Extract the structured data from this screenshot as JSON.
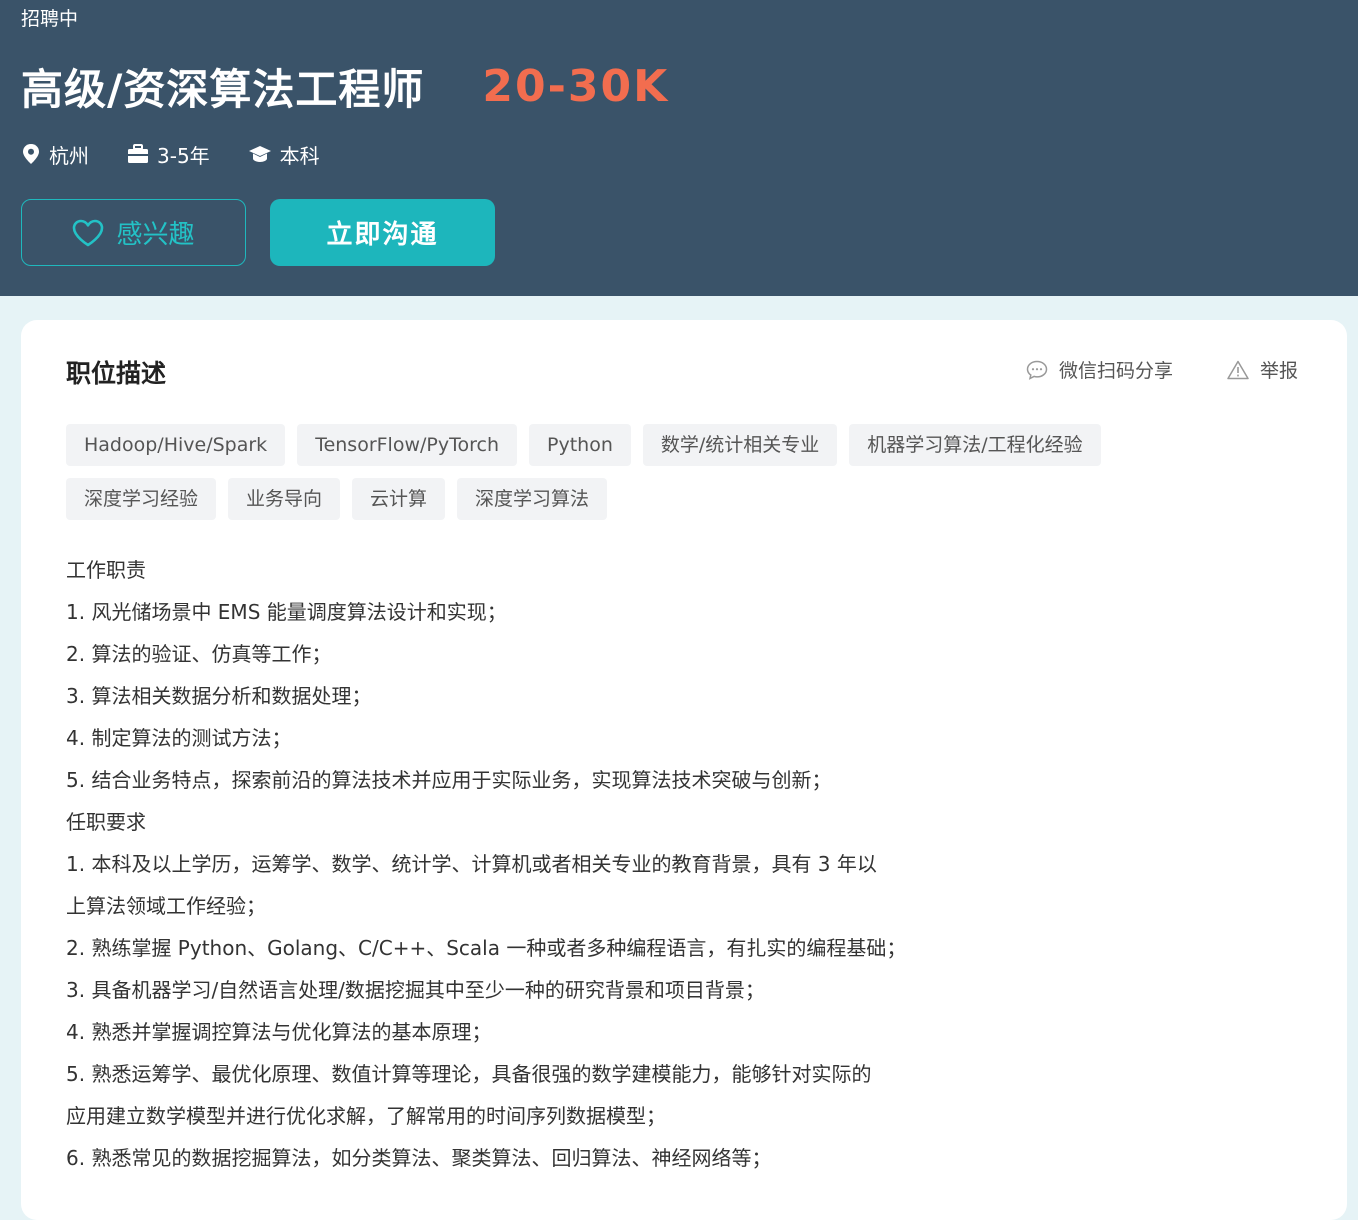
{
  "header": {
    "status": "招聘中",
    "title": "高级/资深算法工程师",
    "salary": "20-30K",
    "location": "杭州",
    "experience": "3-5年",
    "education": "本科",
    "interest_label": "感兴趣",
    "chat_label": "立即沟通"
  },
  "card": {
    "section_title": "职位描述",
    "share_label": "微信扫码分享",
    "report_label": "举报",
    "tags_row1": [
      "Hadoop/Hive/Spark",
      "TensorFlow/PyTorch",
      "Python",
      "数学/统计相关专业",
      "机器学习算法/工程化经验"
    ],
    "tags_row2": [
      "深度学习经验",
      "业务导向",
      "云计算",
      "深度学习算法"
    ],
    "description": [
      "工作职责",
      "1. 风光储场景中 EMS 能量调度算法设计和实现；",
      "2. 算法的验证、仿真等工作；",
      "3. 算法相关数据分析和数据处理；",
      "4. 制定算法的测试方法；",
      "5. 结合业务特点，探索前沿的算法技术并应用于实际业务，实现算法技术突破与创新；",
      "任职要求",
      "1. 本科及以上学历，运筹学、数学、统计学、计算机或者相关专业的教育背景，具有 3 年以",
      "上算法领域工作经验；",
      "2. 熟练掌握 Python、Golang、C/C++、Scala 一种或者多种编程语言，有扎实的编程基础；",
      "3. 具备机器学习/自然语言处理/数据挖掘其中至少一种的研究背景和项目背景；",
      "4. 熟悉并掌握调控算法与优化算法的基本原理；",
      "5. 熟悉运筹学、最优化原理、数值计算等理论，具备很强的数学建模能力，能够针对实际的",
      "应用建立数学模型并进行优化求解，了解常用的时间序列数据模型；",
      "6. 熟悉常见的数据挖掘算法，如分类算法、聚类算法、回归算法、神经网络等；"
    ]
  },
  "colors": {
    "header_bg": "#3a5369",
    "accent_teal": "#1db6bc",
    "salary_orange": "#f26d4f"
  }
}
